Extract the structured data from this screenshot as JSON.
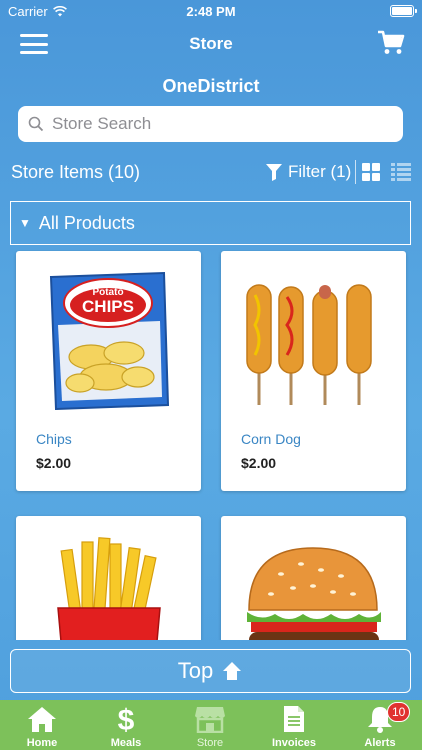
{
  "status_bar": {
    "carrier": "Carrier",
    "time": "2:48 PM"
  },
  "nav": {
    "title": "Store",
    "menu_icon": "hamburger-icon",
    "cart_icon": "cart-icon"
  },
  "district": "OneDistrict",
  "search": {
    "placeholder": "Store Search",
    "value": ""
  },
  "store_items": {
    "label": "Store Items (10)",
    "filter_label": "Filter (1)"
  },
  "category": {
    "label": "All Products"
  },
  "products": [
    {
      "name": "Chips",
      "price": "$2.00",
      "image": "potato-chips-image"
    },
    {
      "name": "Corn Dog",
      "price": "$2.00",
      "image": "corn-dog-image"
    },
    {
      "name": "",
      "price": "",
      "image": "french-fries-image"
    },
    {
      "name": "",
      "price": "",
      "image": "burger-image"
    }
  ],
  "top_button": {
    "label": "Top"
  },
  "tabbar": {
    "items": [
      {
        "label": "Home",
        "icon": "home-icon"
      },
      {
        "label": "Meals",
        "icon": "dollar-icon"
      },
      {
        "label": "Store",
        "icon": "store-icon"
      },
      {
        "label": "Invoices",
        "icon": "invoice-icon"
      },
      {
        "label": "Alerts",
        "icon": "bell-icon"
      }
    ],
    "active": "Store",
    "alerts_badge": "10"
  },
  "colors": {
    "tabbar": "#7dc15a",
    "accent_link": "#3a86c4",
    "badge": "#e0322f"
  }
}
